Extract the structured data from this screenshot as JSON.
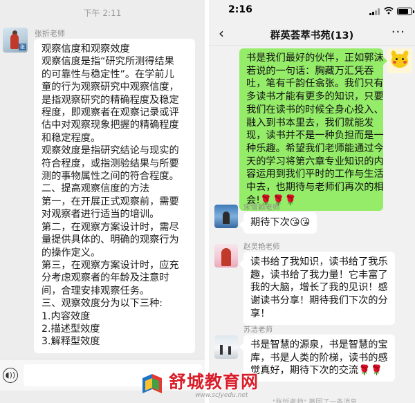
{
  "left_chat": {
    "time": "下午 2:11",
    "sender": "张折老师",
    "avatar_tag": "张",
    "lines": [
      "观察信度和观察效度",
      "观察信度是指“研究所测得结果",
      "的可靠性与稳定性”。在学前儿",
      "童的行为观察研究中观察信度，",
      "是指观察研究的精确程度及稳定",
      "程度，即观察者在观察记录或评",
      "估中对观察现象把握的精确程度",
      "和稳定程度。",
      "观察效度是指研究结论与现实的",
      "符合程度，或指测验结果与所要",
      "测的事物属性之间的符合程度。",
      "二、提高观察信度的方法",
      "第一，在开展正式观察前，需要",
      "对观察者进行适当的培训。",
      "第二，在观察方案设计时，需尽",
      "量提供具体的、明确的观察行为",
      "的操作定义。",
      "第三，在观察方案设计时，应充",
      "分考虑观察者的年龄及注意时",
      "间，合理安排观察任务。",
      "三、观察效度分为以下三种:",
      "1.内容效度",
      "2.描述型效度",
      "3.解释型效度"
    ]
  },
  "right_chat": {
    "clock": "2:16",
    "title": "群英荟萃书苑(13)",
    "back_icon": "chevron-left-icon",
    "more_label": "···",
    "self_message": [
      "书是我们最好的伙伴，正如郭沫",
      "若说的一句话：胸藏万汇凭吞",
      "吐，笔有千韵任翕张。我们只有",
      "多读书才能有更多的知识，只要",
      "我们在读书的时候全身心投入、",
      "融入到书本里去，我们就能发",
      "现，读书并不是一种负担而是一",
      "种乐趣。希望我们老师能通过今",
      "天的学习将第六章专业知识的内",
      "容运用到我们平时的工作与生活",
      "中去，也期待与老师们再次的相",
      "会!🌹🌹🌹"
    ],
    "messages": [
      {
        "sender": "宋雪颖老师",
        "lines": [
          "期待下次😘😘"
        ]
      },
      {
        "sender": "赵灵艳老师",
        "lines": [
          "读书给了我知识，读书给了我乐",
          "趣，读书给了我力量！它丰富了",
          "我的大脑，增长了我的见识！感",
          "谢读书分享！期待我们下次的分",
          "享！"
        ]
      },
      {
        "sender": "苏洁老师",
        "lines": [
          "书是智慧的源泉，书是智慧的宝",
          "库，书是人类的阶梯，读书的感",
          "觉真好，期待下次的交流🌹🌹"
        ]
      }
    ],
    "recall_notice": "\"张忻老师\" 撤回了一条消息"
  },
  "watermark": {
    "text": "舒城教育网",
    "url": "www.scjyedu.net"
  },
  "colors": {
    "self_bubble": "#95ec69",
    "chat_bg": "#ededed",
    "watermark_red": "#d81e2a"
  }
}
